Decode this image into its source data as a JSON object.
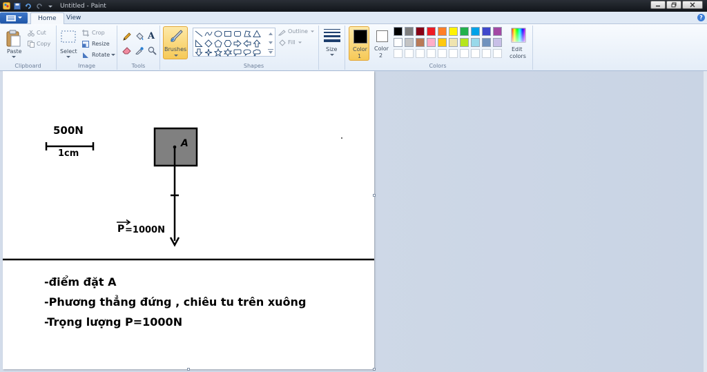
{
  "window": {
    "title": "Untitled - Paint"
  },
  "tabs": [
    {
      "label": "Home"
    },
    {
      "label": "View"
    }
  ],
  "clipboard": {
    "paste": "Paste",
    "cut": "Cut",
    "copy": "Copy",
    "group": "Clipboard"
  },
  "image": {
    "select": "Select",
    "crop": "Crop",
    "resize": "Resize",
    "rotate": "Rotate",
    "group": "Image"
  },
  "tools": {
    "group": "Tools"
  },
  "brushes": {
    "label": "Brushes"
  },
  "shapes": {
    "outline": "Outline",
    "fill": "Fill",
    "group": "Shapes"
  },
  "size": {
    "label": "Size"
  },
  "colors": {
    "color1_label": "Color",
    "color1_num": "1",
    "color2_label": "Color",
    "color2_num": "2",
    "edit_label": "Edit",
    "edit_label2": "colors",
    "group": "Colors",
    "color1_value": "#000000",
    "color2_value": "#ffffff",
    "palette_row1": [
      "#000000",
      "#7f7f7f",
      "#880015",
      "#ed1c24",
      "#ff7f27",
      "#fff200",
      "#22b14c",
      "#00a2e8",
      "#3f48cc",
      "#a349a4"
    ],
    "palette_row2": [
      "#ffffff",
      "#c3c3c3",
      "#b97a57",
      "#ffaec9",
      "#ffc90e",
      "#efe4b0",
      "#b5e61d",
      "#99d9ea",
      "#7092be",
      "#c8bfe7"
    ],
    "palette_row3": [
      "#ffffff",
      "#ffffff",
      "#ffffff",
      "#ffffff",
      "#ffffff",
      "#ffffff",
      "#ffffff",
      "#ffffff",
      "#ffffff",
      "#ffffff"
    ]
  },
  "canvas": {
    "scale_force": "500N",
    "scale_length": "1cm",
    "point_label": "A",
    "vector_symbol": "P",
    "vector_value": "=1000N",
    "line1": "-điểm đặt A",
    "line2": "-Phương thẳng đứng , chiêu tu trên xuông",
    "line3": "-Trọng lượng P=1000N",
    "box_fill": "#808080",
    "ink": "#000000"
  }
}
